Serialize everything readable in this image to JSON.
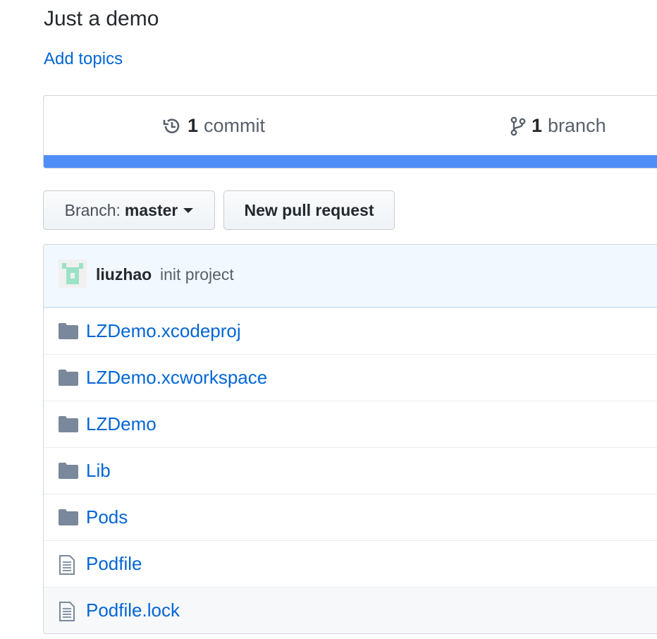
{
  "repo": {
    "description": "Just a demo",
    "add_topics": "Add topics"
  },
  "summary": {
    "commits": {
      "count": "1",
      "label": "commit",
      "icon": "history-icon"
    },
    "branches": {
      "count": "1",
      "label": "branch",
      "icon": "git-branch-icon"
    },
    "language_color": "#4f8ef7"
  },
  "toolbar": {
    "branch_prefix": "Branch:",
    "branch_name": "master",
    "new_pr": "New pull request"
  },
  "last_commit": {
    "author": "liuzhao",
    "message": "init project",
    "avatar_color": "#9be2c7"
  },
  "files": [
    {
      "name": "LZDemo.xcodeproj",
      "type": "folder",
      "icon": "folder-icon"
    },
    {
      "name": "LZDemo.xcworkspace",
      "type": "folder",
      "icon": "folder-icon"
    },
    {
      "name": "LZDemo",
      "type": "folder",
      "icon": "folder-icon"
    },
    {
      "name": "Lib",
      "type": "folder",
      "icon": "folder-icon"
    },
    {
      "name": "Pods",
      "type": "folder",
      "icon": "folder-icon"
    },
    {
      "name": "Podfile",
      "type": "file",
      "icon": "file-icon"
    },
    {
      "name": "Podfile.lock",
      "type": "file",
      "icon": "file-icon"
    }
  ],
  "colors": {
    "link": "#0366d6",
    "folder": "#79889a",
    "text": "#24292e",
    "muted": "#586069"
  }
}
